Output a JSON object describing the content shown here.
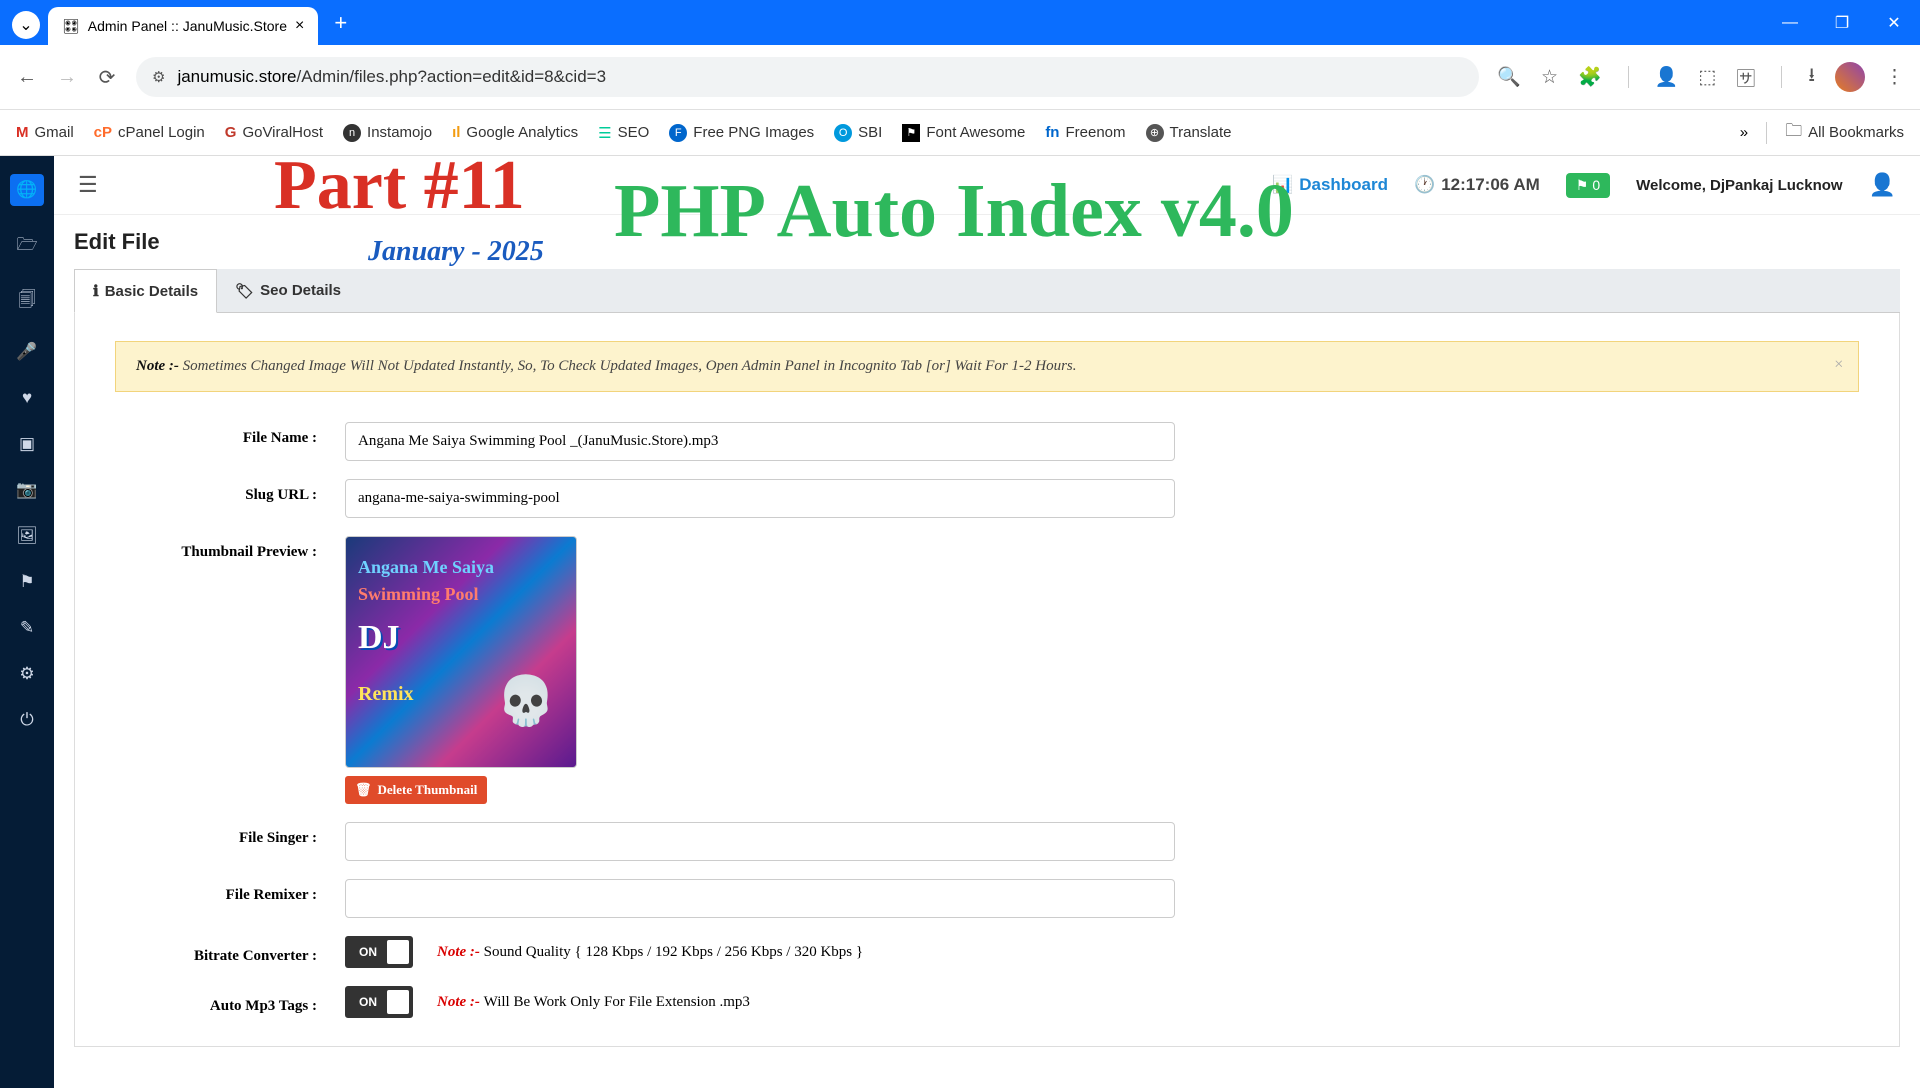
{
  "browser": {
    "tab_title": "Admin Panel :: JanuMusic.Store",
    "url_domain": "janumusic.store",
    "url_path": "/Admin/files.php?action=edit&id=8&cid=3"
  },
  "bookmarks": [
    {
      "label": "Gmail",
      "icon": "M"
    },
    {
      "label": "cPanel Login",
      "icon": "cP"
    },
    {
      "label": "GoViralHost",
      "icon": "G"
    },
    {
      "label": "Instamojo",
      "icon": "n"
    },
    {
      "label": "Google Analytics",
      "icon": "ıl"
    },
    {
      "label": "SEO",
      "icon": "☰"
    },
    {
      "label": "Free PNG Images",
      "icon": "F"
    },
    {
      "label": "SBI",
      "icon": "O"
    },
    {
      "label": "Font Awesome",
      "icon": "⚑"
    },
    {
      "label": "Freenom",
      "icon": "fn"
    },
    {
      "label": "Translate",
      "icon": "⊕"
    }
  ],
  "all_bookmarks_label": "All Bookmarks",
  "overlay": {
    "part": "Part #11",
    "date": "January - 2025",
    "php": "PHP Auto Index v4.0"
  },
  "topbar": {
    "dashboard": "Dashboard",
    "clock": "12:17:06 AM",
    "flag_count": "0",
    "welcome": "Welcome, DjPankaj Lucknow"
  },
  "page": {
    "title": "Edit File",
    "tab_basic": "Basic Details",
    "tab_seo": "Seo Details",
    "alert_prefix": "Note :- ",
    "alert_text": "Sometimes Changed Image Will Not Updated Instantly, So, To Check Updated Images, Open Admin Panel in Incognito Tab [or] Wait For 1-2 Hours."
  },
  "form": {
    "file_name_label": "File Name :",
    "file_name_value": "Angana Me Saiya Swimming Pool _(JanuMusic.Store).mp3",
    "slug_label": "Slug URL :",
    "slug_value": "angana-me-saiya-swimming-pool",
    "thumb_label": "Thumbnail Preview :",
    "thumb_t1": "Angana Me Saiya",
    "thumb_t2": "Swimming Pool",
    "thumb_t3": "DJ",
    "thumb_t4": "Remix",
    "delete_thumb": "Delete Thumbnail",
    "singer_label": "File Singer :",
    "singer_value": "",
    "remixer_label": "File Remixer :",
    "remixer_value": "",
    "bitrate_label": "Bitrate Converter :",
    "bitrate_toggle": "ON",
    "bitrate_note_prefix": "Note :- ",
    "bitrate_note": "Sound Quality { 128 Kbps / 192 Kbps / 256 Kbps / 320 Kbps }",
    "autotag_label": "Auto Mp3 Tags :",
    "autotag_toggle": "ON",
    "autotag_note_prefix": "Note :- ",
    "autotag_note": "Will Be Work Only For File Extension .mp3"
  }
}
